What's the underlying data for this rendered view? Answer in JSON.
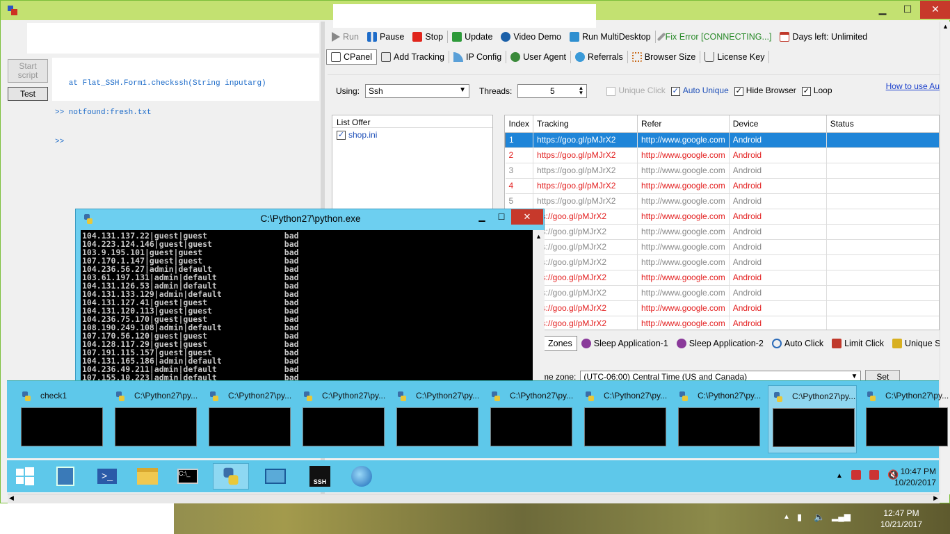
{
  "window": {
    "minimize": "▁",
    "maximize": "☐",
    "close": "✕"
  },
  "left": {
    "start_script": "Start\nscript",
    "test": "Test",
    "console_lines": [
      "   at Flat_SSH.Form1.checkssh(String inputarg)",
      ">> notfound:fresh.txt",
      ">>"
    ]
  },
  "toolbar1": [
    {
      "name": "run",
      "label": "Run",
      "color": "#8a8a8a"
    },
    {
      "name": "pause",
      "label": "Pause",
      "color": "#1e6cc9"
    },
    {
      "name": "stop",
      "label": "Stop",
      "color": "#e0251c"
    },
    {
      "name": "update",
      "label": "Update",
      "color": "#2e9a3a"
    },
    {
      "name": "video-demo",
      "label": "Video Demo",
      "color": "#1a5fa8"
    },
    {
      "name": "run-multidesktop",
      "label": "Run MultiDesktop",
      "color": "#2e8fd0"
    },
    {
      "name": "fix-error",
      "label": "Fix Error [CONNECTING...]",
      "color": "#888"
    },
    {
      "name": "days-left",
      "label": "Days left: Unlimited",
      "color": "#c0392b"
    }
  ],
  "toolbar2": [
    {
      "name": "cpanel",
      "label": "CPanel"
    },
    {
      "name": "add-tracking",
      "label": "Add Tracking"
    },
    {
      "name": "ip-config",
      "label": "IP Config"
    },
    {
      "name": "user-agent",
      "label": "User Agent"
    },
    {
      "name": "referrals",
      "label": "Referrals"
    },
    {
      "name": "browser-size",
      "label": "Browser Size"
    },
    {
      "name": "license-key",
      "label": "License Key"
    }
  ],
  "settings": {
    "using_label": "Using:",
    "using_value": "Ssh",
    "threads_label": "Threads:",
    "threads_value": "5",
    "unique_click": "Unique Click",
    "auto_unique": "Auto Unique",
    "hide_browser": "Hide Browser",
    "loop": "Loop",
    "howto": "How to use Au"
  },
  "offers": {
    "header": "List Offer",
    "items": [
      "shop.ini"
    ]
  },
  "grid": {
    "headers": [
      "Index",
      "Tracking",
      "Refer",
      "Device",
      "Status"
    ],
    "rows": [
      [
        "1",
        "https://goo.gl/pMJrX2",
        "http://www.google.com",
        "Android",
        ""
      ],
      [
        "2",
        "https://goo.gl/pMJrX2",
        "http://www.google.com",
        "Android",
        ""
      ],
      [
        "3",
        "https://goo.gl/pMJrX2",
        "http://www.google.com",
        "Android",
        ""
      ],
      [
        "4",
        "https://goo.gl/pMJrX2",
        "http://www.google.com",
        "Android",
        ""
      ],
      [
        "5",
        "https://goo.gl/pMJrX2",
        "http://www.google.com",
        "Android",
        ""
      ],
      [
        "",
        "ps://goo.gl/pMJrX2",
        "http://www.google.com",
        "Android",
        ""
      ],
      [
        "",
        "ps://goo.gl/pMJrX2",
        "http://www.google.com",
        "Android",
        ""
      ],
      [
        "",
        "ps://goo.gl/pMJrX2",
        "http://www.google.com",
        "Android",
        ""
      ],
      [
        "",
        "ps://goo.gl/pMJrX2",
        "http://www.google.com",
        "Android",
        ""
      ],
      [
        "",
        "ps://goo.gl/pMJrX2",
        "http://www.google.com",
        "Android",
        ""
      ],
      [
        "",
        "ps://goo.gl/pMJrX2",
        "http://www.google.com",
        "Android",
        ""
      ],
      [
        "",
        "ps://goo.gl/pMJrX2",
        "http://www.google.com",
        "Android",
        ""
      ],
      [
        "",
        "ps://goo.gl/pMJrX2",
        "http://www.google.com",
        "Android",
        ""
      ]
    ],
    "row_styles": [
      "sel",
      "red",
      "gray",
      "red",
      "gray",
      "red",
      "gray",
      "gray",
      "gray",
      "red",
      "gray",
      "red",
      "red"
    ]
  },
  "bottom_tabs": [
    "Zones",
    "Sleep Application-1",
    "Sleep Application-2",
    "Auto Click",
    "Limit Click",
    "Unique S"
  ],
  "timezone": {
    "label": "me zone:",
    "value": "(UTC-06:00) Central Time (US and Canada)",
    "set": "Set"
  },
  "python_window": {
    "title": "C:\\Python27\\python.exe",
    "lines": [
      "104.131.137.22|guest|guest                bad",
      "104.223.124.146|guest|guest               bad",
      "103.9.195.101|guest|guest                 bad",
      "107.170.1.147|guest|guest                 bad",
      "104.236.56.27|admin|default               bad",
      "103.61.197.131|admin|default              bad",
      "104.131.126.53|admin|default              bad",
      "104.131.133.129|admin|default             bad",
      "104.131.127.41|guest|guest                bad",
      "104.131.120.113|guest|guest               bad",
      "104.236.75.170|guest|guest                bad",
      "108.190.249.108|admin|default             bad",
      "107.170.56.120|guest|guest                bad",
      "104.128.117.29|guest|guest                bad",
      "107.191.115.157|guest|guest               bad",
      "104.131.165.186|admin|default             bad",
      "104.236.49.211|admin|default              bad",
      "107.155.10.223|admin|default              bad"
    ]
  },
  "thumbnails": [
    "check1",
    "C:\\Python27\\py...",
    "C:\\Python27\\py...",
    "C:\\Python27\\py...",
    "C:\\Python27\\py...",
    "C:\\Python27\\py...",
    "C:\\Python27\\py...",
    "C:\\Python27\\py...",
    "C:\\Python27\\py...",
    "C:\\Python27\\py..."
  ],
  "taskbar": {
    "clock_time": "10:47 PM",
    "clock_date": "10/20/2017"
  },
  "host_tray": {
    "time": "12:47 PM",
    "date": "10/21/2017"
  }
}
